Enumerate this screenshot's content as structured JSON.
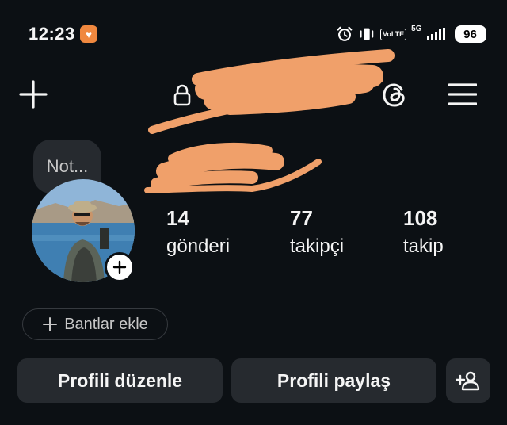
{
  "status_bar": {
    "time": "12:23",
    "volte": "VoLTE",
    "network": "5G",
    "battery": "96"
  },
  "header": {
    "new_post_icon": "plus-icon",
    "private_icon": "lock-icon",
    "threads_icon": "threads-icon",
    "menu_icon": "hamburger-menu-icon"
  },
  "profile": {
    "note_placeholder": "Not...",
    "stats": [
      {
        "value": "14",
        "label": "gönderi"
      },
      {
        "value": "77",
        "label": "takipçi"
      },
      {
        "value": "108",
        "label": "takip"
      }
    ],
    "badges_chip": "Bantlar ekle"
  },
  "actions": {
    "edit_profile": "Profili düzenle",
    "share_profile": "Profili paylaş"
  },
  "colors": {
    "background": "#0c1014",
    "surface": "#262a2f",
    "scribble": "#f0a06a",
    "status_badge": "#f0883f"
  }
}
